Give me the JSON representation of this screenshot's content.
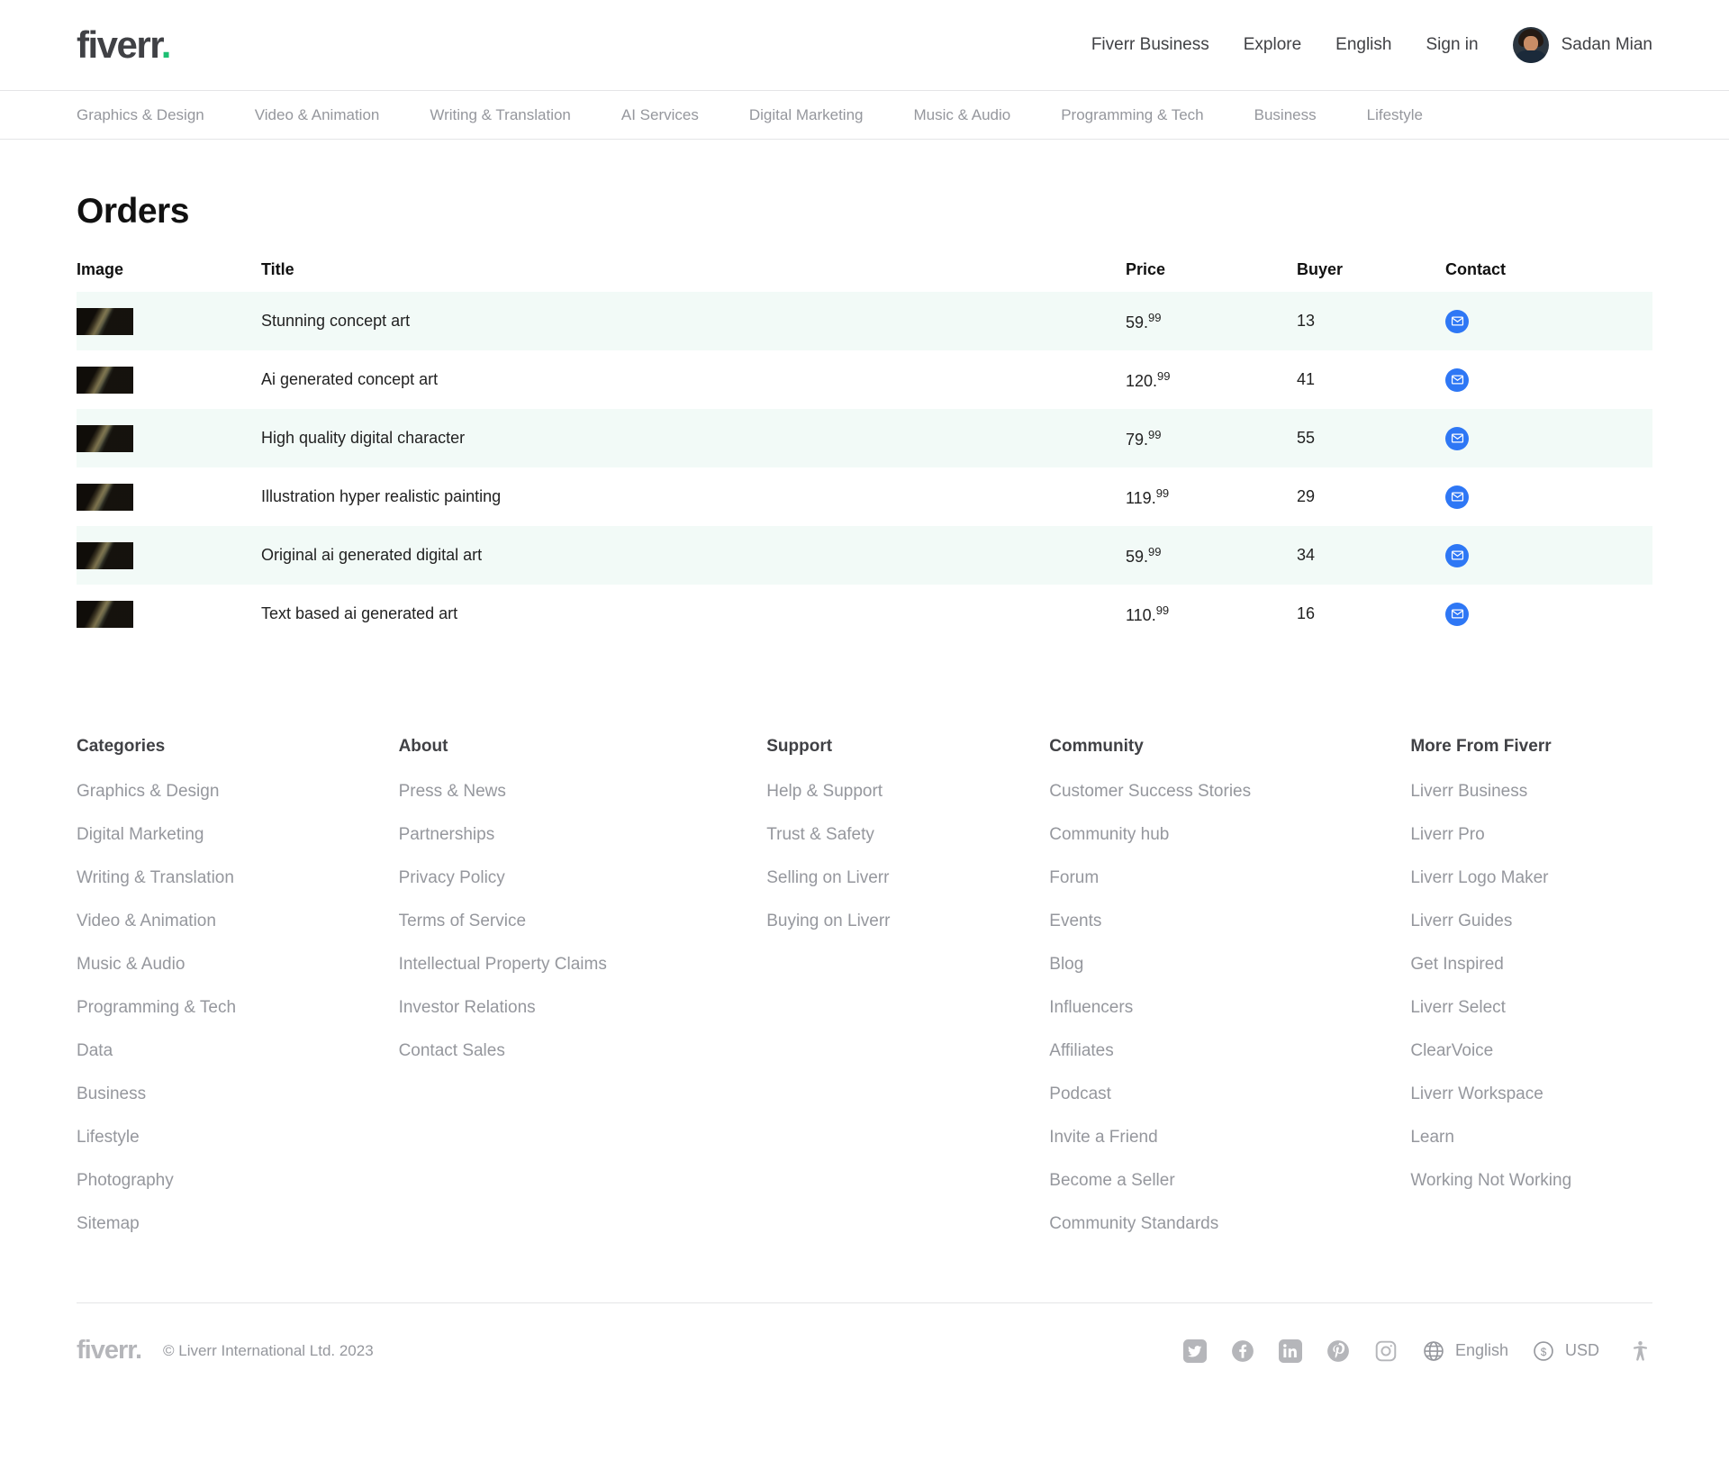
{
  "header": {
    "logo_text": "fiverr",
    "logo_dot": ".",
    "links": [
      {
        "label": "Fiverr Business",
        "name": "fiverr-business"
      },
      {
        "label": "Explore",
        "name": "explore"
      },
      {
        "label": "English",
        "name": "english"
      },
      {
        "label": "Sign in",
        "name": "sign-in"
      }
    ],
    "user_name": "Sadan Mian"
  },
  "category_nav": [
    "Graphics & Design",
    "Video & Animation",
    "Writing & Translation",
    "AI Services",
    "Digital Marketing",
    "Music & Audio",
    "Programming & Tech",
    "Business",
    "Lifestyle"
  ],
  "main": {
    "page_title": "Orders",
    "columns": [
      "Image",
      "Title",
      "Price",
      "Buyer",
      "Contact"
    ],
    "contact_icon": "envelope-icon",
    "contact_icon_color": "#2e77f5",
    "row_stripe_color": "#f2faf7",
    "rows": [
      {
        "title": "Stunning concept art",
        "price_main": "59.",
        "price_cents": "99",
        "buyer": "13"
      },
      {
        "title": "Ai generated concept art",
        "price_main": "120.",
        "price_cents": "99",
        "buyer": "41"
      },
      {
        "title": "High quality digital character",
        "price_main": "79.",
        "price_cents": "99",
        "buyer": "55"
      },
      {
        "title": "Illustration hyper realistic painting",
        "price_main": "119.",
        "price_cents": "99",
        "buyer": "29"
      },
      {
        "title": "Original ai generated digital art",
        "price_main": "59.",
        "price_cents": "99",
        "buyer": "34"
      },
      {
        "title": "Text based ai generated art",
        "price_main": "110.",
        "price_cents": "99",
        "buyer": "16"
      }
    ]
  },
  "footer": {
    "columns": [
      {
        "heading": "Categories",
        "links": [
          "Graphics & Design",
          "Digital Marketing",
          "Writing & Translation",
          "Video & Animation",
          "Music & Audio",
          "Programming & Tech",
          "Data",
          "Business",
          "Lifestyle",
          "Photography",
          "Sitemap"
        ]
      },
      {
        "heading": "About",
        "links": [
          "Press & News",
          "Partnerships",
          "Privacy Policy",
          "Terms of Service",
          "Intellectual Property Claims",
          "Investor Relations",
          "Contact Sales"
        ]
      },
      {
        "heading": "Support",
        "links": [
          "Help & Support",
          "Trust & Safety",
          "Selling on Liverr",
          "Buying on Liverr"
        ]
      },
      {
        "heading": "Community",
        "links": [
          "Customer Success Stories",
          "Community hub",
          "Forum",
          "Events",
          "Blog",
          "Influencers",
          "Affiliates",
          "Podcast",
          "Invite a Friend",
          "Become a Seller",
          "Community Standards"
        ]
      },
      {
        "heading": "More From Fiverr",
        "links": [
          "Liverr Business",
          "Liverr Pro",
          "Liverr Logo Maker",
          "Liverr Guides",
          "Get Inspired",
          "Liverr Select",
          "ClearVoice",
          "Liverr Workspace",
          "Learn",
          "Working Not Working"
        ]
      }
    ],
    "logo_text": "fiverr.",
    "copyright": "© Liverr International Ltd. 2023",
    "social": [
      "twitter-icon",
      "facebook-icon",
      "linkedin-icon",
      "pinterest-icon",
      "instagram-icon"
    ],
    "language": "English",
    "currency": "USD",
    "accessibility_icon": "accessibility-icon"
  }
}
